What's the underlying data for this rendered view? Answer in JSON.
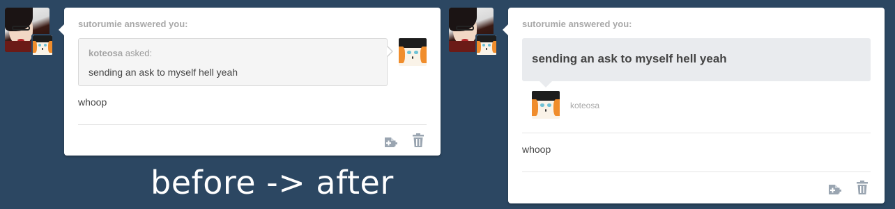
{
  "before": {
    "header": "sutorumie answered you:",
    "asker_name": "koteosa",
    "asked_label": "asked:",
    "question": "sending an ask to myself hell yeah",
    "answer": "whoop"
  },
  "after": {
    "header": "sutorumie answered you:",
    "question": "sending an ask to myself hell yeah",
    "asker_name": "koteosa",
    "answer": "whoop"
  },
  "caption": "before -> after",
  "icons": {
    "reblog": "reblog-icon",
    "delete": "trash-icon"
  },
  "colors": {
    "background": "#2c4762",
    "card": "#ffffff",
    "icon": "#9aa5b1"
  }
}
